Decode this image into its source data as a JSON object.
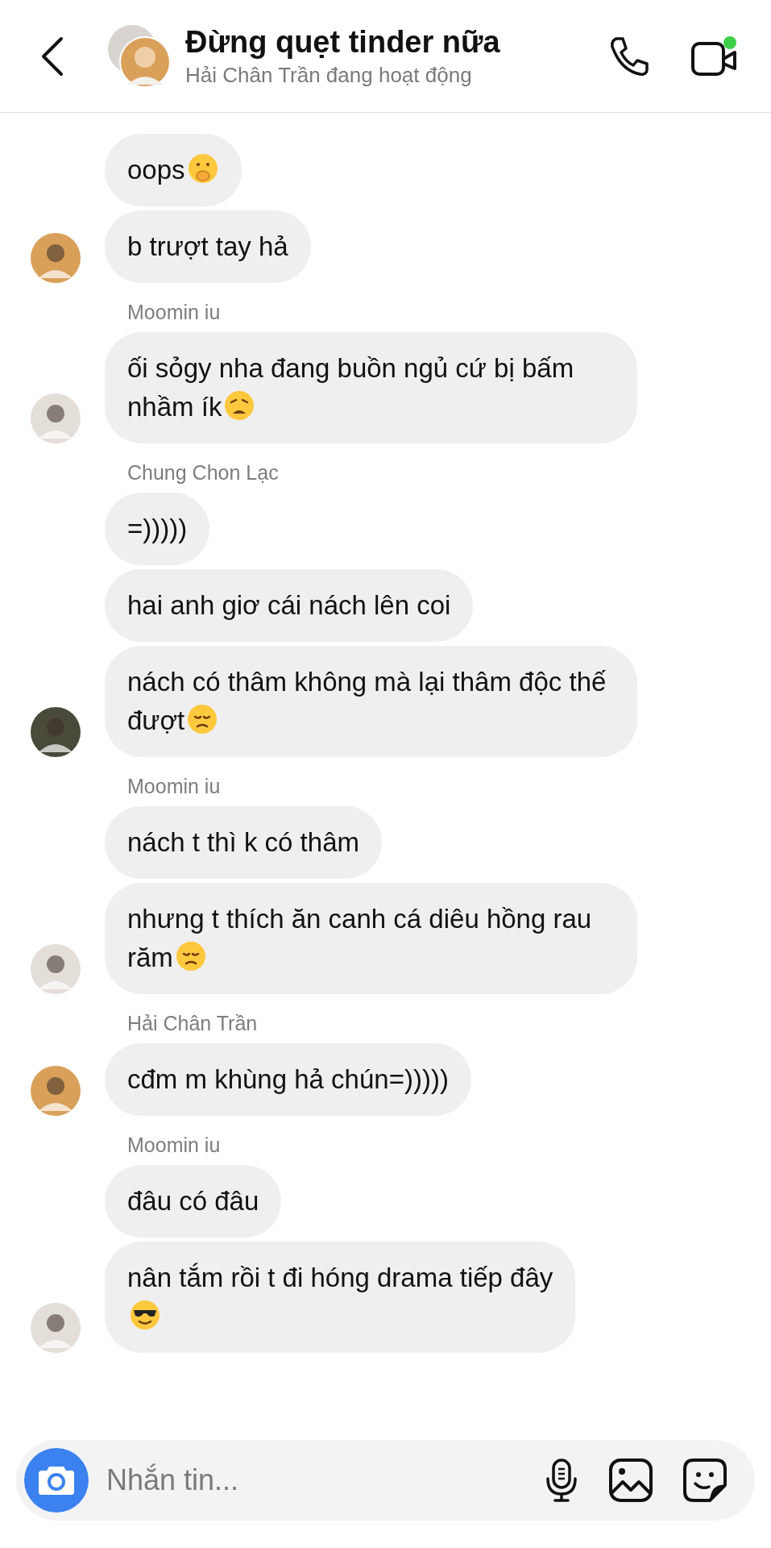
{
  "header": {
    "title": "Đừng quẹt tinder nữa",
    "status": "Hải Chân Trần đang hoạt động",
    "video_active": true
  },
  "groups": [
    {
      "messages": [
        {
          "text": "oops",
          "kind": "shush"
        },
        {
          "text": "b trượt tay hả",
          "kind": "plain"
        }
      ]
    },
    {
      "sender": "Moomin iu",
      "messages": [
        {
          "text": "ối sỏgy nha đang buồn ngủ cứ bị bấm nhầm ík",
          "kind": "weary"
        }
      ]
    },
    {
      "sender": "Chung Chon Lạc",
      "messages": [
        {
          "text": "=)))))",
          "kind": "plain"
        },
        {
          "text": "hai anh giơ cái nách lên coi",
          "kind": "plain"
        },
        {
          "text": "nách có thâm không mà lại thâm độc thế đượt",
          "kind": "disappointed"
        }
      ]
    },
    {
      "sender": "Moomin iu",
      "messages": [
        {
          "text": "nách t thì k có thâm",
          "kind": "plain"
        },
        {
          "text": "nhưng t thích ăn canh cá diêu hồng rau răm",
          "kind": "pensive"
        }
      ]
    },
    {
      "sender": "Hải Chân Trần",
      "messages": [
        {
          "text": "cđm m khùng hả chún=)))))",
          "kind": "plain"
        }
      ]
    },
    {
      "sender": "Moomin iu",
      "messages": [
        {
          "text": "đâu có đâu",
          "kind": "plain"
        },
        {
          "text": "nân tắm rồi t đi hóng drama tiếp đây",
          "kind": "sunglasses",
          "emoji_own_line": true
        }
      ]
    }
  ],
  "composer": {
    "placeholder": "Nhắn tin..."
  }
}
